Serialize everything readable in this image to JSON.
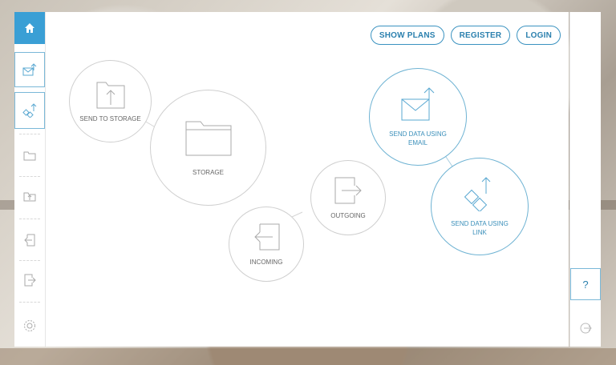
{
  "header": {
    "show_plans": "SHOW PLANS",
    "register": "REGISTER",
    "login": "LOGIN"
  },
  "bubbles": {
    "send_to_storage": "SEND TO STORAGE",
    "storage": "STORAGE",
    "incoming": "INCOMING",
    "outgoing": "OUTGOING",
    "send_email_l1": "SEND DATA USING",
    "send_email_l2": "EMAIL",
    "send_link_l1": "SEND DATA USING",
    "send_link_l2": "LINK"
  },
  "right_sidebar": {
    "help": "?"
  },
  "sidebar_icons": [
    "home-icon",
    "email-send-icon",
    "link-send-icon",
    "folder-icon",
    "upload-icon",
    "incoming-icon",
    "outgoing-icon",
    "settings-icon"
  ],
  "colors": {
    "accent": "#3a9fd5",
    "accent_border": "#6fb3d3",
    "grey_border": "#cfcfcf"
  }
}
